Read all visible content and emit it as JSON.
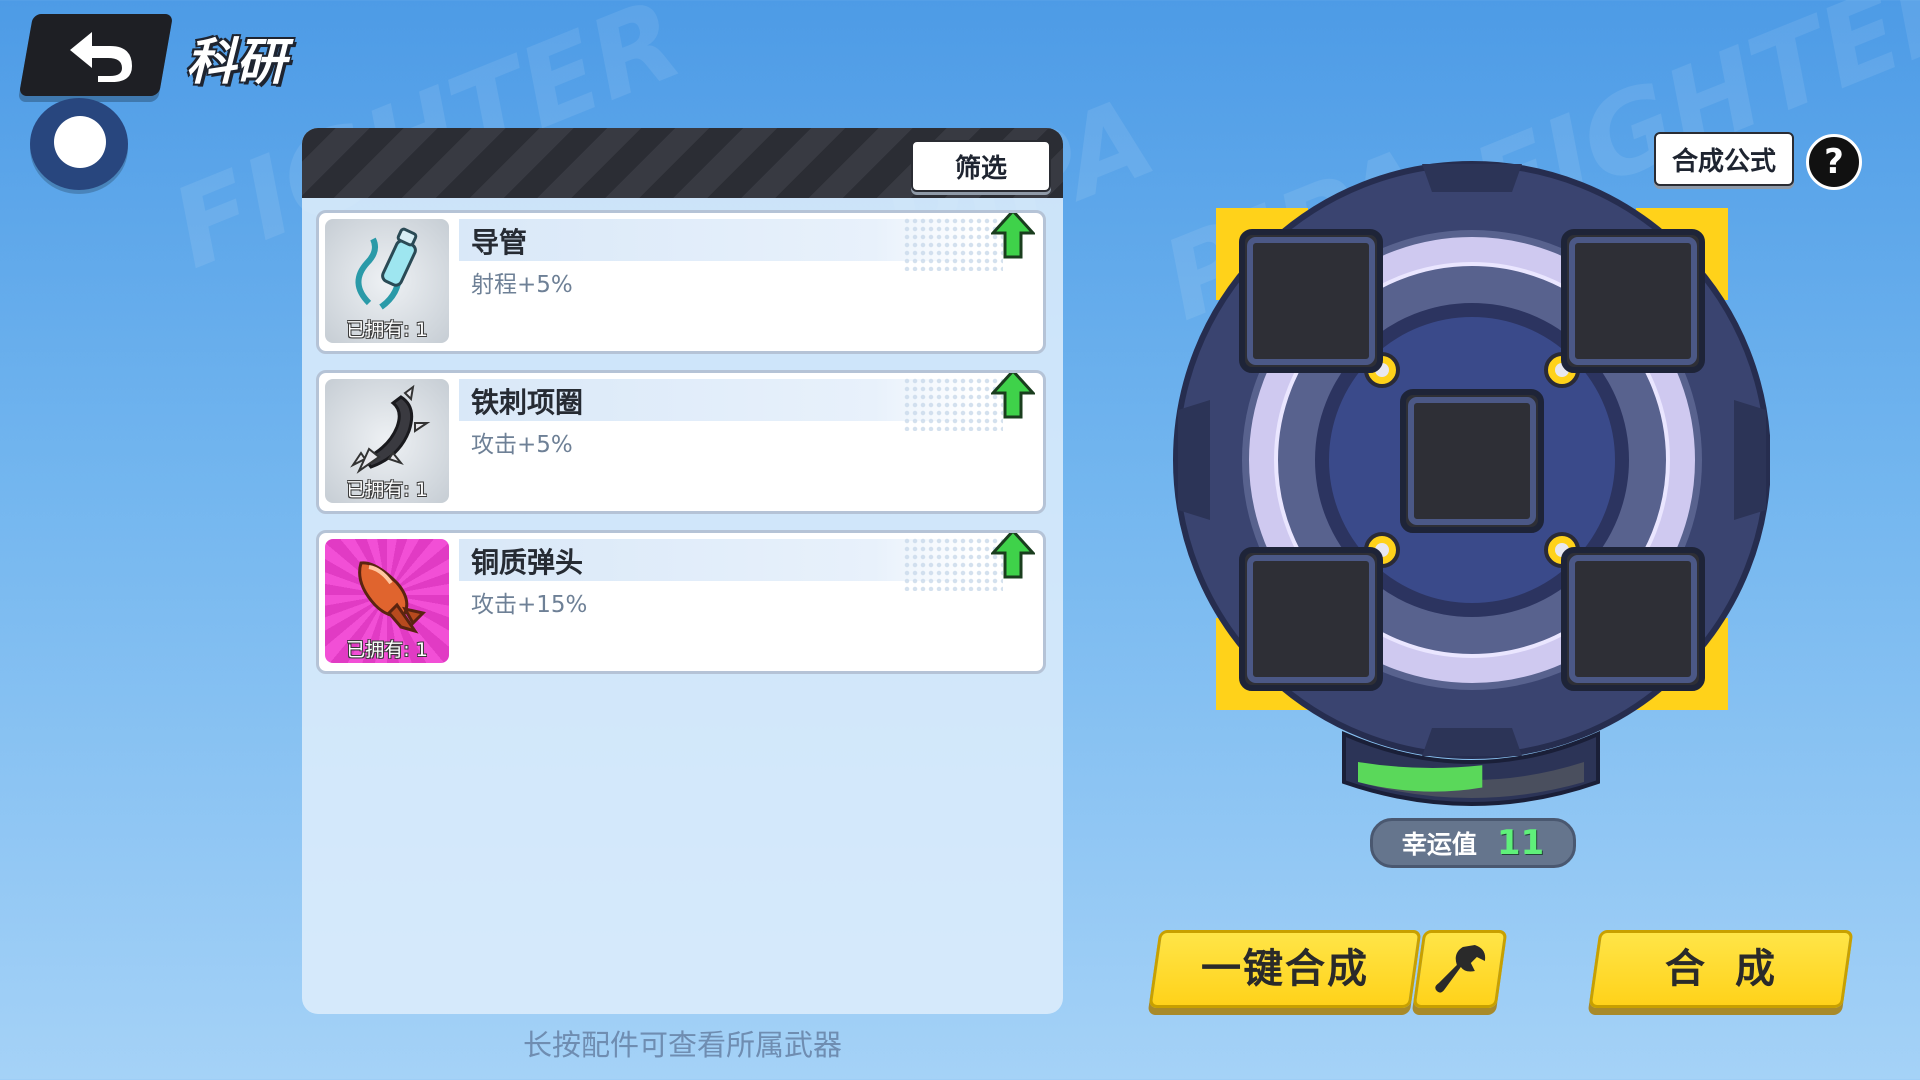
{
  "header": {
    "title": "科研"
  },
  "panel": {
    "filter_label": "筛选"
  },
  "items": [
    {
      "name": "导管",
      "stat": "射程+5%",
      "owned": "已拥有: 1",
      "icon": "tube-icon",
      "rarity": "grey"
    },
    {
      "name": "铁刺项圈",
      "stat": "攻击+5%",
      "owned": "已拥有: 1",
      "icon": "spiked-collar-icon",
      "rarity": "grey"
    },
    {
      "name": "铜质弹头",
      "stat": "攻击+15%",
      "owned": "已拥有: 1",
      "icon": "copper-warhead-icon",
      "rarity": "pink"
    }
  ],
  "hint": "长按配件可查看所属武器",
  "synth": {
    "formula_label": "合成公式",
    "help_label": "?",
    "luck_label": "幸运值",
    "luck_value": "11",
    "luck_progress": 0.55,
    "one_click_label": "一键合成",
    "combine_label": "合成"
  },
  "colors": {
    "accent_yellow": "#ffd21a",
    "luck_green": "#5ff07a",
    "rare_pink": "#f24fd6"
  }
}
